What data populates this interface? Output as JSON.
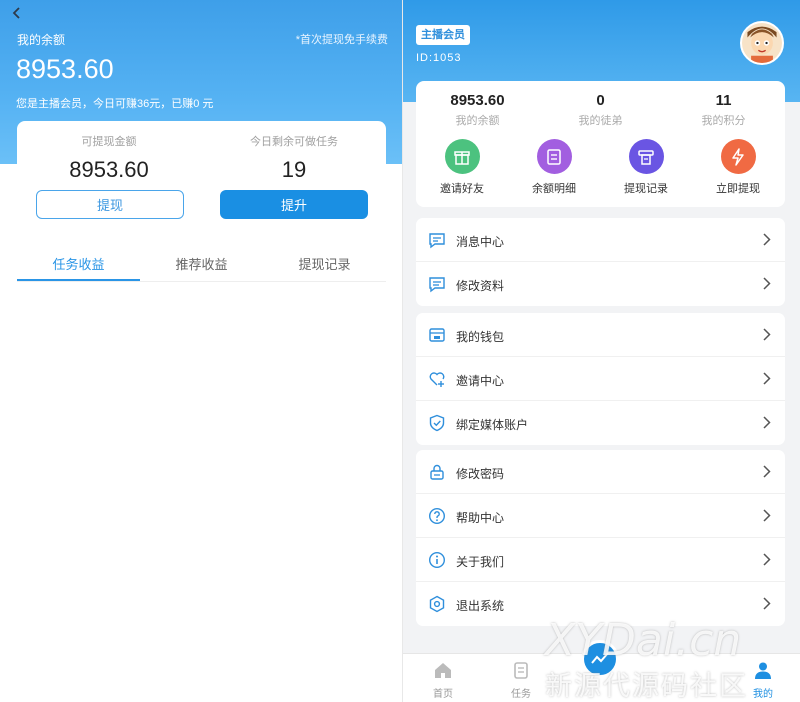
{
  "left": {
    "title": "我的余额",
    "tip": "*首次提现免手续费",
    "amount": "8953.60",
    "note": "您是主播会员，今日可赚36元，已赚0 元",
    "card": {
      "withdrawable_label": "可提现金额",
      "withdrawable_value": "8953.60",
      "tasks_label": "今日剩余可做任务",
      "tasks_value": "19",
      "withdraw_button": "提现",
      "upgrade_button": "提升"
    },
    "tabs": [
      "任务收益",
      "推荐收益",
      "提现记录"
    ]
  },
  "right": {
    "badge": "主播会员",
    "user_id": "ID:1053",
    "stats": [
      {
        "value": "8953.60",
        "label": "我的余额"
      },
      {
        "value": "0",
        "label": "我的徒弟"
      },
      {
        "value": "11",
        "label": "我的积分"
      }
    ],
    "actions": [
      {
        "label": "邀请好友",
        "icon": "gift-icon",
        "color": "#4cc27f"
      },
      {
        "label": "余额明细",
        "icon": "document-icon",
        "color": "#a25ee0"
      },
      {
        "label": "提现记录",
        "icon": "receipt-icon",
        "color": "#6a55e3"
      },
      {
        "label": "立即提现",
        "icon": "lightning-icon",
        "color": "#f06a43"
      }
    ],
    "group1": [
      "消息中心",
      "修改资料"
    ],
    "group2": [
      "我的钱包",
      "邀请中心",
      "绑定媒体账户"
    ],
    "group3": [
      "修改密码",
      "帮助中心",
      "关于我们",
      "退出系统"
    ],
    "tabbar": [
      "首页",
      "任务",
      "我的"
    ]
  },
  "watermark": {
    "line1": "XYDai.cn",
    "line2": "新源代源码社区"
  },
  "colors": {
    "primary": "#1a8fe3",
    "header": "#3e9fe9"
  }
}
